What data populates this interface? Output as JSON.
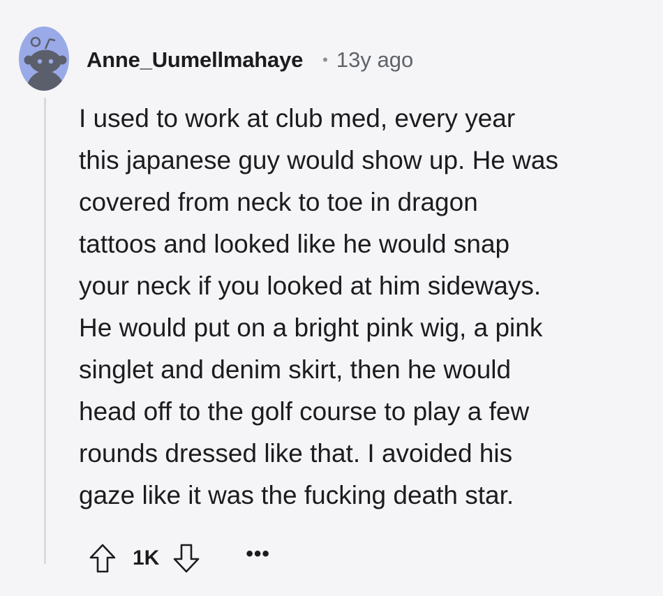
{
  "comment": {
    "author": "Anne_Uumellmahaye",
    "separator": "•",
    "timestamp": "13y ago",
    "body_lines": [
      "I used to work at club med, every year",
      "this japanese guy would show up. He was",
      "covered from neck to toe in dragon",
      "tattoos and looked like he would snap",
      "your neck if you looked at him sideways.",
      "He would put on a bright pink wig, a pink",
      "singlet and denim skirt, then he would",
      "head off to the golf course to play a few",
      "rounds dressed like that. I avoided his",
      "gaze like it was the fucking death star."
    ],
    "score": "1K",
    "more_label": "•••"
  },
  "icons": {
    "avatar": "snoo-avatar-icon",
    "upvote": "upvote-arrow-icon",
    "downvote": "downvote-arrow-icon",
    "more": "ellipsis-icon"
  },
  "colors": {
    "background": "#f5f5f7",
    "avatar_bg": "#9aaae8",
    "thread_line": "#d6dae0",
    "text": "#1c1c1e",
    "meta": "#5f6368"
  }
}
